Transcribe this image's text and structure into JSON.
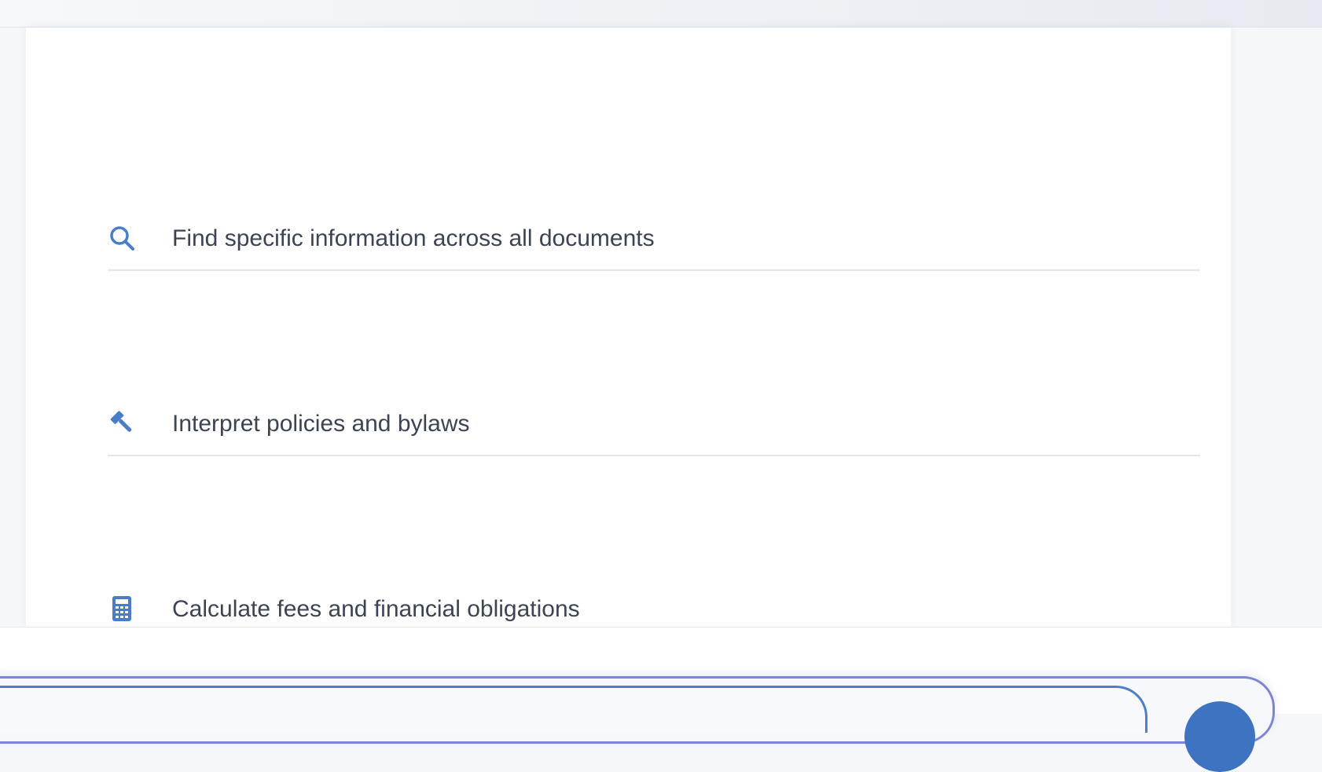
{
  "features": [
    {
      "icon": "search-icon",
      "label": "Find specific information across all documents"
    },
    {
      "icon": "gavel-icon",
      "label": "Interpret policies and bylaws"
    },
    {
      "icon": "calculator-icon",
      "label": "Calculate fees and financial obligations"
    }
  ],
  "colors": {
    "icon": "#4a7cc7",
    "text": "#3c4454",
    "composer_border": "#7b86d9",
    "input_border": "#4f7fc6",
    "send_button": "#3e73c2"
  }
}
